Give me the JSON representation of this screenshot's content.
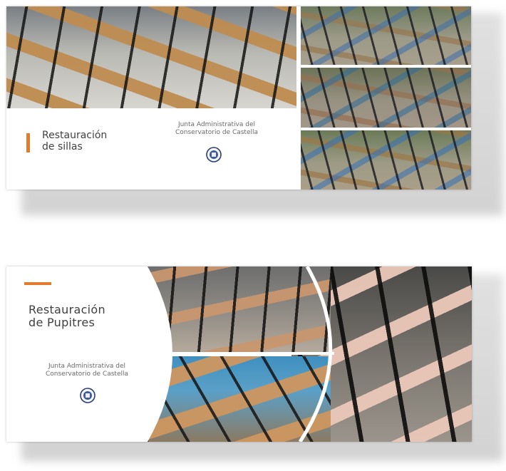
{
  "slides": [
    {
      "title_line1": "Restauración",
      "title_line2": "de sillas",
      "org_line1": "Junta Administrativa del",
      "org_line2": "Conservatorio de Castella",
      "seal_icon": "institution-seal-icon"
    },
    {
      "title_line1": "Restauración",
      "title_line2": "de Pupitres",
      "org_line1": "Junta Administrativa del",
      "org_line2": "Conservatorio de Castella",
      "seal_icon": "institution-seal-icon"
    }
  ],
  "colors": {
    "accent": "#e37a2e",
    "title_text": "#404040"
  }
}
